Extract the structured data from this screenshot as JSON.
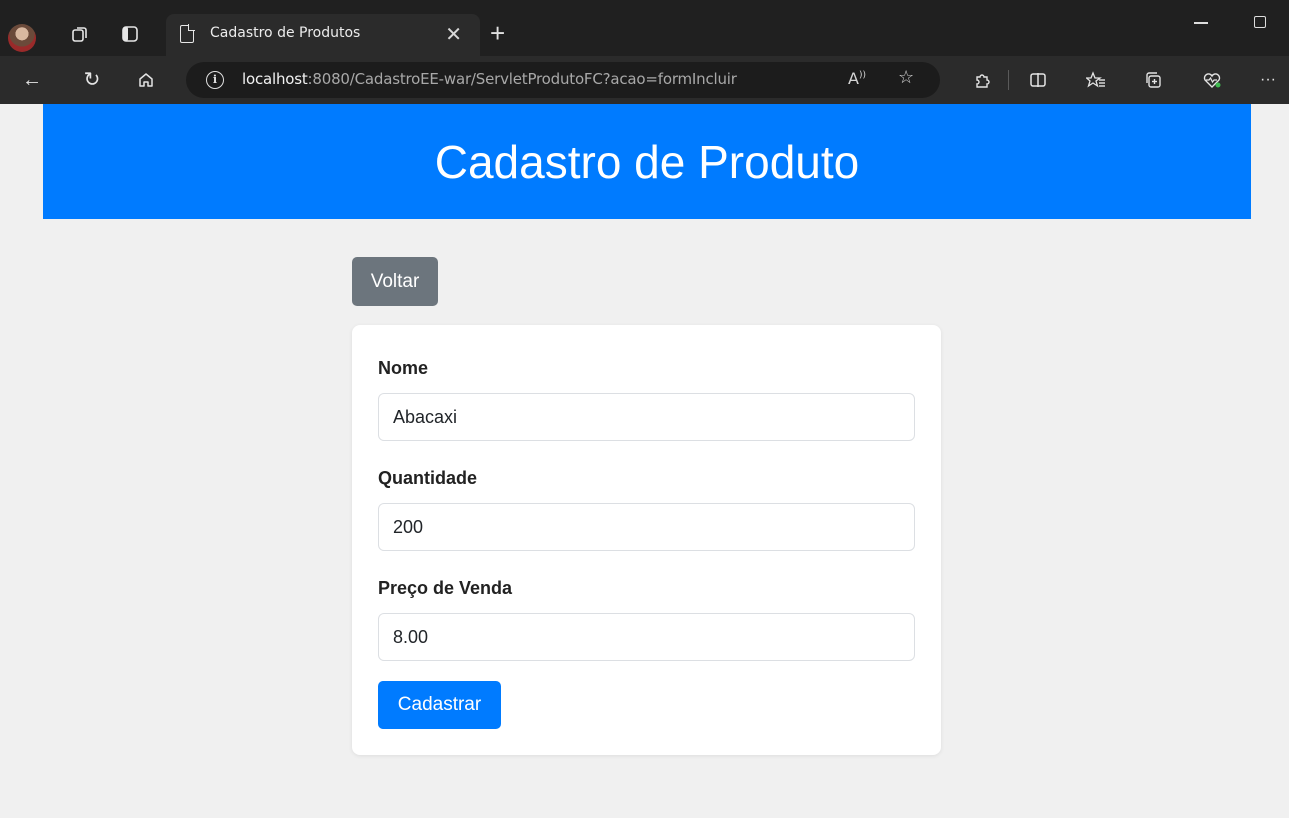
{
  "browser": {
    "tab_title": "Cadastro de Produtos",
    "url_host": "localhost",
    "url_rest": ":8080/CadastroEE-war/ServletProdutoFC?acao=formIncluir"
  },
  "page": {
    "heading": "Cadastro de Produto",
    "back_button": "Voltar",
    "form": {
      "nome_label": "Nome",
      "nome_value": "Abacaxi",
      "quantidade_label": "Quantidade",
      "quantidade_value": "200",
      "preco_label": "Preço de Venda",
      "preco_value": "8.00",
      "submit_label": "Cadastrar"
    }
  },
  "colors": {
    "primary": "#007bff",
    "secondary": "#6c757d",
    "background": "#f0f0f0"
  },
  "icons": [
    "profile-avatar",
    "workspaces-icon",
    "tab-actions-icon",
    "page-icon",
    "close-icon",
    "new-tab-icon",
    "back-icon",
    "refresh-icon",
    "home-icon",
    "info-icon",
    "read-aloud-icon",
    "favorite-star-icon",
    "extensions-icon",
    "split-screen-icon",
    "favorites-icon",
    "collections-icon",
    "browser-essentials-icon",
    "more-icon"
  ]
}
